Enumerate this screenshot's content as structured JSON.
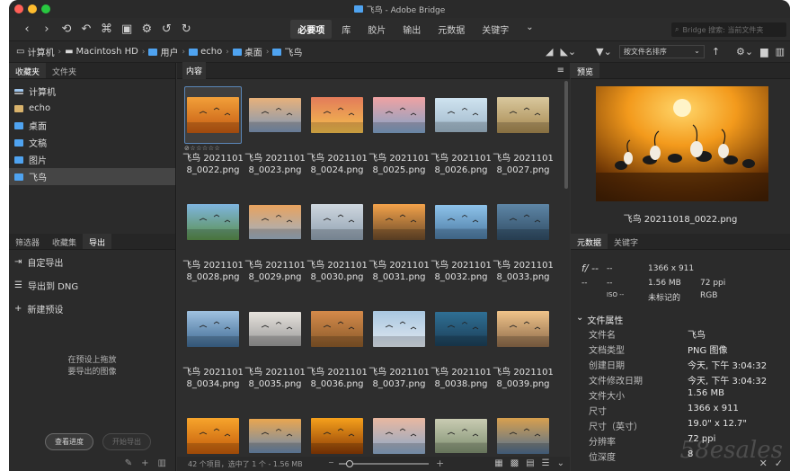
{
  "window": {
    "title": "飞鸟 - Adobe Bridge"
  },
  "toolbar": {
    "icons": [
      "‹",
      "›",
      "⟲",
      "↶",
      "⌘",
      "▣",
      "⚙",
      "↺",
      "↻"
    ],
    "workspaces": [
      "必要项",
      "库",
      "胶片",
      "输出",
      "元数据",
      "关键字"
    ],
    "workspace_more": "⌄",
    "search_placeholder": "Bridge 搜索: 当前文件夹"
  },
  "pathbar": {
    "crumbs": [
      "计算机",
      "Macintosh HD",
      "用户",
      "echo",
      "桌面",
      "飞鸟"
    ],
    "sort_label": "按文件名排序"
  },
  "left": {
    "top_tabs": [
      "收藏夹",
      "文件夹"
    ],
    "favorites": [
      {
        "label": "计算机",
        "icon": "computer-icon"
      },
      {
        "label": "echo",
        "icon": "home-icon"
      },
      {
        "label": "桌面",
        "icon": "folder-icon"
      },
      {
        "label": "文稿",
        "icon": "folder-icon"
      },
      {
        "label": "图片",
        "icon": "folder-icon"
      },
      {
        "label": "飞鸟",
        "icon": "folder-icon"
      }
    ],
    "bottom_tabs": [
      "筛选器",
      "收藏集",
      "导出"
    ],
    "export_items": [
      "自定导出",
      "导出到 DNG",
      "新建预设"
    ],
    "export_hint_line1": "在预设上拖放",
    "export_hint_line2": "要导出的图像",
    "view_progress": "查看进度",
    "start_export": "开始导出"
  },
  "content": {
    "tab_label": "内容",
    "stars": "⊘☆☆☆☆☆",
    "files": [
      {
        "line1": "飞鸟 2021101",
        "line2": "8_0022.png"
      },
      {
        "line1": "飞鸟 2021101",
        "line2": "8_0023.png"
      },
      {
        "line1": "飞鸟 2021101",
        "line2": "8_0024.png"
      },
      {
        "line1": "飞鸟 2021101",
        "line2": "8_0025.png"
      },
      {
        "line1": "飞鸟 2021101",
        "line2": "8_0026.png"
      },
      {
        "line1": "飞鸟 2021101",
        "line2": "8_0027.png"
      },
      {
        "line1": "飞鸟 2021101",
        "line2": "8_0028.png"
      },
      {
        "line1": "飞鸟 2021101",
        "line2": "8_0029.png"
      },
      {
        "line1": "飞鸟 2021101",
        "line2": "8_0030.png"
      },
      {
        "line1": "飞鸟 2021101",
        "line2": "8_0031.png"
      },
      {
        "line1": "飞鸟 2021101",
        "line2": "8_0032.png"
      },
      {
        "line1": "飞鸟 2021101",
        "line2": "8_0033.png"
      },
      {
        "line1": "飞鸟 2021101",
        "line2": "8_0034.png"
      },
      {
        "line1": "飞鸟 2021101",
        "line2": "8_0035.png"
      },
      {
        "line1": "飞鸟 2021101",
        "line2": "8_0036.png"
      },
      {
        "line1": "飞鸟 2021101",
        "line2": "8_0037.png"
      },
      {
        "line1": "飞鸟 2021101",
        "line2": "8_0038.png"
      },
      {
        "line1": "飞鸟 2021101",
        "line2": "8_0039.png"
      },
      {
        "line1": "",
        "line2": ""
      },
      {
        "line1": "",
        "line2": ""
      },
      {
        "line1": "",
        "line2": ""
      },
      {
        "line1": "",
        "line2": ""
      },
      {
        "line1": "",
        "line2": ""
      },
      {
        "line1": "",
        "line2": ""
      }
    ],
    "status": "42 个项目，选中了 1 个 - 1.56 MB"
  },
  "right": {
    "preview_tab": "预览",
    "preview_name": "飞鸟 20211018_0022.png",
    "meta_tabs": [
      "元数据",
      "关键字"
    ],
    "quick": {
      "aperture": "f/ --",
      "shutter": "--",
      "dash1": "--",
      "dash2": "--",
      "iso": "ISO --",
      "dims": "1366 x 911",
      "size": "1.56 MB",
      "ppi": "72 ppi",
      "tagged": "未标记的",
      "mode": "RGB"
    },
    "props_title": "文件属性",
    "props": [
      {
        "k": "文件名",
        "v": "飞鸟"
      },
      {
        "k": "文档类型",
        "v": "PNG 图像"
      },
      {
        "k": "创建日期",
        "v": "今天, 下午 3:04:32"
      },
      {
        "k": "文件修改日期",
        "v": "今天, 下午 3:04:32"
      },
      {
        "k": "文件大小",
        "v": "1.56 MB"
      },
      {
        "k": "尺寸",
        "v": "1366 x 911"
      },
      {
        "k": "尺寸（英寸）",
        "v": "19.0\" x 12.7\""
      },
      {
        "k": "分辨率",
        "v": "72 ppi"
      },
      {
        "k": "位深度",
        "v": "8"
      }
    ],
    "watermark": "58esales"
  }
}
